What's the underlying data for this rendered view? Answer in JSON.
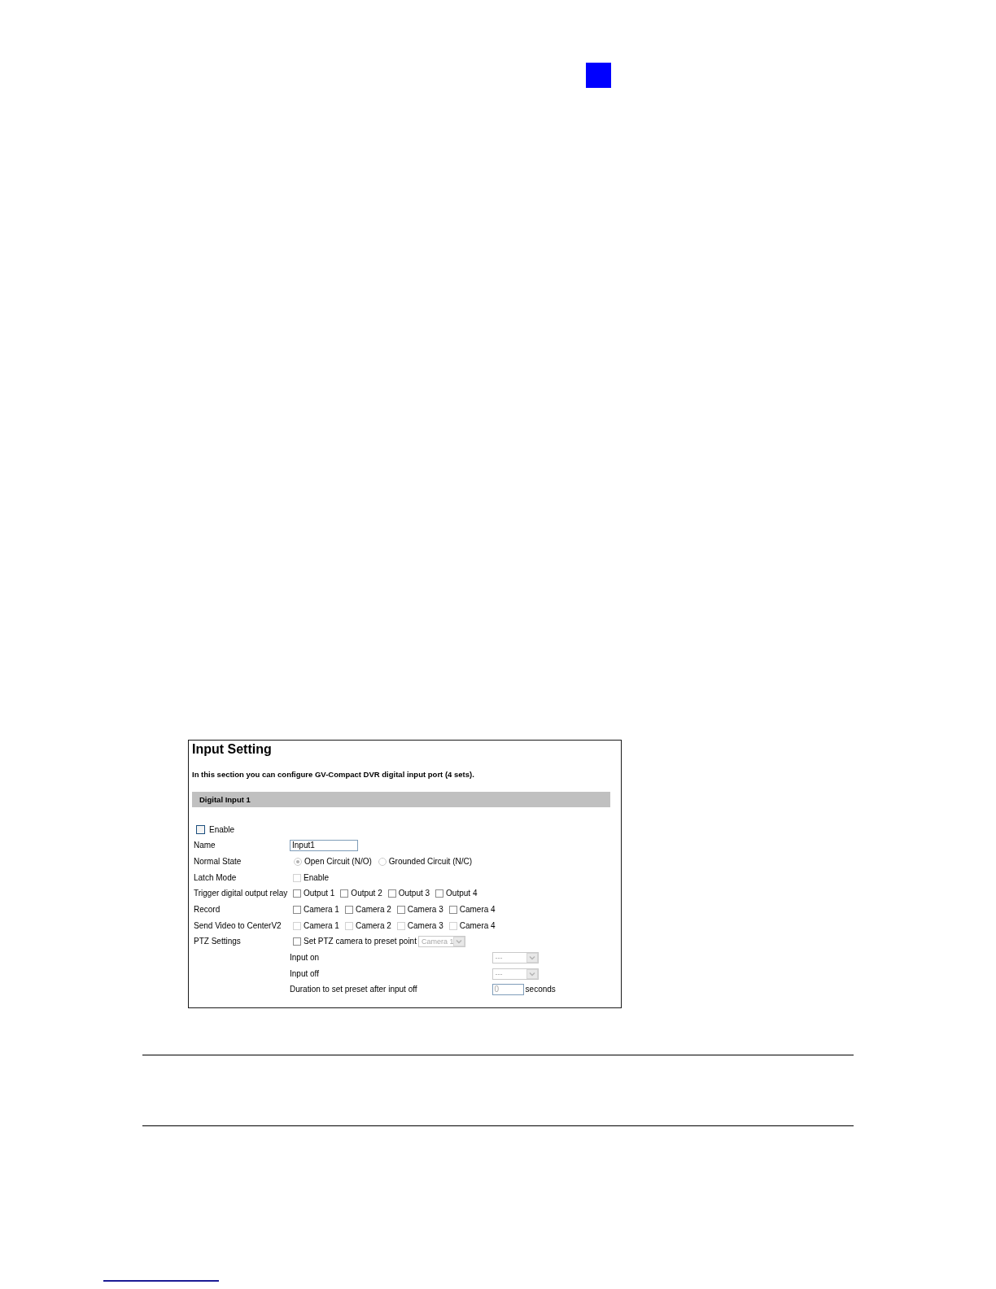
{
  "panel": {
    "title": "Input Setting",
    "description": "In this section you can configure GV-Compact DVR digital input port (4 sets).",
    "section_header": "Digital Input 1",
    "enable": {
      "label": "Enable",
      "checked": false
    },
    "rows": [
      {
        "kind": "field",
        "label": "Name",
        "value": "Input1",
        "disabled": false
      },
      {
        "kind": "radios",
        "label": "Normal State",
        "options": [
          {
            "label": "Open Circuit (N/O)",
            "selected": true,
            "disabled": true
          },
          {
            "label": "Grounded Circuit (N/C)",
            "selected": false,
            "disabled": true
          }
        ]
      },
      {
        "kind": "checks",
        "label": "Latch Mode",
        "options": [
          {
            "label": "Enable",
            "checked": false,
            "disabled": true
          }
        ]
      },
      {
        "kind": "checks",
        "label": "Trigger digital output relay",
        "options": [
          {
            "label": "Output 1",
            "checked": false,
            "disabled": false
          },
          {
            "label": "Output 2",
            "checked": false,
            "disabled": false
          },
          {
            "label": "Output 3",
            "checked": false,
            "disabled": false
          },
          {
            "label": "Output 4",
            "checked": false,
            "disabled": false
          }
        ]
      },
      {
        "kind": "checks",
        "label": "Record",
        "options": [
          {
            "label": "Camera 1",
            "checked": false,
            "disabled": false
          },
          {
            "label": "Camera 2",
            "checked": false,
            "disabled": false
          },
          {
            "label": "Camera 3",
            "checked": false,
            "disabled": false
          },
          {
            "label": "Camera 4",
            "checked": false,
            "disabled": false
          }
        ]
      },
      {
        "kind": "checks",
        "label": "Send Video to CenterV2",
        "options": [
          {
            "label": "Camera 1",
            "checked": false,
            "disabled": true
          },
          {
            "label": "Camera 2",
            "checked": false,
            "disabled": true
          },
          {
            "label": "Camera 3",
            "checked": false,
            "disabled": true
          },
          {
            "label": "Camera 4",
            "checked": false,
            "disabled": true
          }
        ]
      },
      {
        "kind": "check_select",
        "label": "PTZ Settings",
        "option": {
          "label": "Set PTZ camera to preset point",
          "checked": false,
          "disabled": false
        },
        "select": {
          "value": "Camera 1",
          "disabled": true
        }
      },
      {
        "kind": "sub_select",
        "label": "Input on",
        "select": {
          "value": "---",
          "disabled": true
        }
      },
      {
        "kind": "sub_select",
        "label": "Input off",
        "select": {
          "value": "---",
          "disabled": true
        }
      },
      {
        "kind": "sub_field",
        "label": "Duration to set preset after input off",
        "value": "0",
        "disabled": true,
        "unit": "seconds"
      }
    ]
  }
}
